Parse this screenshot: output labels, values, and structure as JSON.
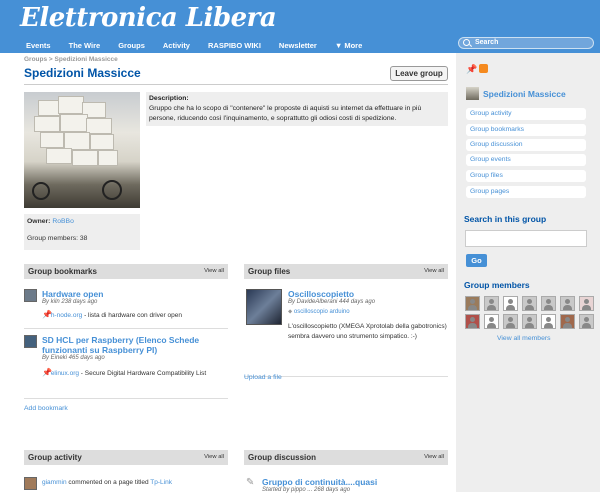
{
  "site": {
    "title": "Elettronica Libera",
    "nav": [
      "Events",
      "The Wire",
      "Groups",
      "Activity",
      "RASPIBO WIKI",
      "Newsletter",
      "▼ More"
    ],
    "search_label": "Search"
  },
  "breadcrumb": "Groups > Spedizioni Massicce",
  "page": {
    "title": "Spedizioni Massicce",
    "leave_button": "Leave group",
    "description_label": "Description:",
    "description": "Gruppo che ha lo scopo di \"contenere\" le proposte di aquisti su internet da effettuare in più persone, riducendo così l'inquinamento, e soprattutto gli odiosi costi di spedizione.",
    "owner_label": "Owner:",
    "owner": "RoBBo",
    "members_label": "Group members: 38"
  },
  "bookmarks": {
    "title": "Group bookmarks",
    "view_all": "View all",
    "items": [
      {
        "title": "Hardware open",
        "meta": "By kiln 238 days ago",
        "link": "h-node.org",
        "desc": " - lista di hardware con driver open"
      },
      {
        "title": "SD HCL per Raspberry (Elenco Schede funzionanti su Raspberry PI)",
        "meta": "By Eineki 465 days ago",
        "link": "elinux.org",
        "desc": " - Secure Digital Hardware Compatibility List"
      }
    ],
    "add": "Add bookmark"
  },
  "files": {
    "title": "Group files",
    "view_all": "View all",
    "item": {
      "title": "Oscilloscopietto",
      "meta": "By DavideAlberani 444 days ago",
      "tag": "oscilloscopio arduino",
      "desc": "L'oscilloscopietto (XMEGA Xprotolab della gabotronics) sembra davvero uno strumento simpatico. :-)"
    },
    "upload": "Upload a file"
  },
  "activity": {
    "title": "Group activity",
    "view_all": "View all",
    "user": "giammin",
    "text": " commented on a page titled ",
    "target": "Tp-Link"
  },
  "discussion": {
    "title": "Group discussion",
    "view_all": "View all",
    "item": "Gruppo di continuità....quasi",
    "meta": "Started by pippo ... 268 days ago"
  },
  "sidebar": {
    "group_name": "Spedizioni Massicce",
    "links": [
      "Group activity",
      "Group bookmarks",
      "Group discussion",
      "Group events",
      "Group files",
      "Group pages"
    ],
    "search_heading": "Search in this group",
    "go": "Go",
    "members_heading": "Group members",
    "view_all_members": "View all members"
  },
  "colors": {
    "accent": "#4690d6",
    "title": "#0054a7",
    "panel": "#dddddd"
  }
}
